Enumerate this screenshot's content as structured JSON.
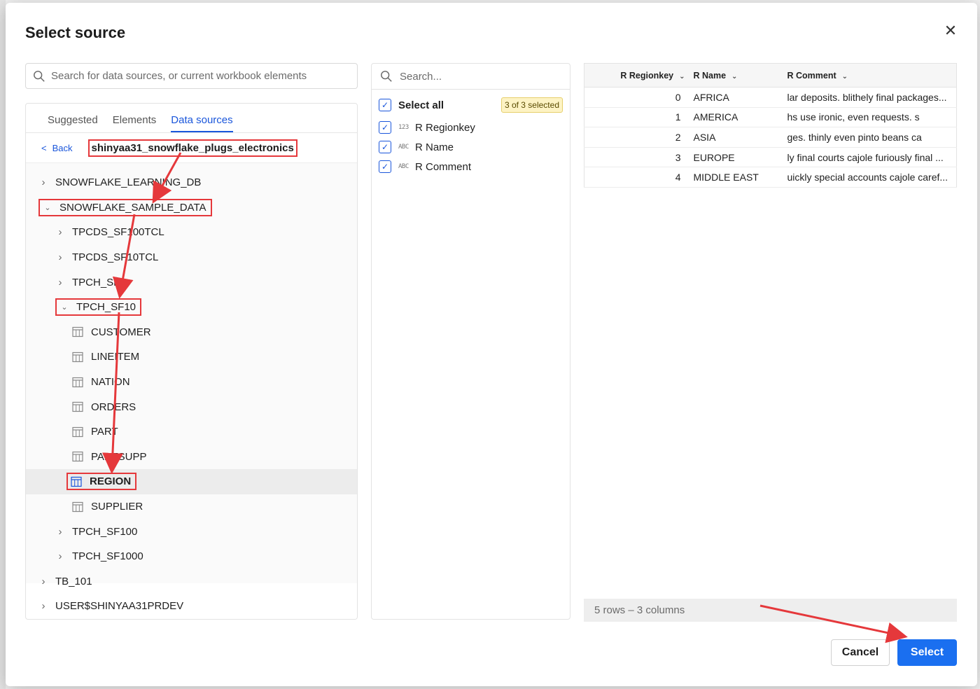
{
  "dialog": {
    "title": "Select source",
    "search_placeholder": "Search for data sources, or current workbook elements"
  },
  "tabs": [
    {
      "label": "Suggested"
    },
    {
      "label": "Elements"
    },
    {
      "label": "Data sources",
      "active": true
    }
  ],
  "breadcrumb": {
    "back_label": "Back",
    "current": "shinyaa31_snowflake_plugs_electronics"
  },
  "tree": [
    {
      "label": "SNOWFLAKE_LEARNING_DB",
      "level": 0,
      "expanded": false
    },
    {
      "label": "SNOWFLAKE_SAMPLE_DATA",
      "level": 0,
      "expanded": true
    },
    {
      "label": "TPCDS_SF100TCL",
      "level": 1,
      "expanded": false
    },
    {
      "label": "TPCDS_SF10TCL",
      "level": 1,
      "expanded": false
    },
    {
      "label": "TPCH_SF1",
      "level": 1,
      "expanded": false
    },
    {
      "label": "TPCH_SF10",
      "level": 1,
      "expanded": true
    },
    {
      "label": "CUSTOMER",
      "level": 2,
      "table": true
    },
    {
      "label": "LINEITEM",
      "level": 2,
      "table": true
    },
    {
      "label": "NATION",
      "level": 2,
      "table": true
    },
    {
      "label": "ORDERS",
      "level": 2,
      "table": true
    },
    {
      "label": "PART",
      "level": 2,
      "table": true
    },
    {
      "label": "PARTSUPP",
      "level": 2,
      "table": true
    },
    {
      "label": "REGION",
      "level": 2,
      "table": true,
      "selected": true
    },
    {
      "label": "SUPPLIER",
      "level": 2,
      "table": true
    },
    {
      "label": "TPCH_SF100",
      "level": 1,
      "expanded": false
    },
    {
      "label": "TPCH_SF1000",
      "level": 1,
      "expanded": false
    },
    {
      "label": "TB_101",
      "level": 0,
      "expanded": false
    },
    {
      "label": "USER$SHINYAA31PRDEV",
      "level": 0,
      "expanded": false
    }
  ],
  "columns_panel": {
    "search_placeholder": "Search...",
    "select_all_label": "Select all",
    "selected_badge": "3 of 3 selected",
    "columns": [
      {
        "type": "123",
        "label": "R Regionkey",
        "checked": true
      },
      {
        "type": "ABC",
        "label": "R Name",
        "checked": true
      },
      {
        "type": "ABC",
        "label": "R Comment",
        "checked": true
      }
    ]
  },
  "preview": {
    "headers": [
      "R Regionkey",
      "R Name",
      "R Comment"
    ],
    "rows": [
      [
        "0",
        "AFRICA",
        "lar deposits. blithely final packages..."
      ],
      [
        "1",
        "AMERICA",
        "hs use ironic, even requests. s"
      ],
      [
        "2",
        "ASIA",
        "ges. thinly even pinto beans ca"
      ],
      [
        "3",
        "EUROPE",
        "ly final courts cajole furiously final ..."
      ],
      [
        "4",
        "MIDDLE EAST",
        "uickly special accounts cajole caref..."
      ]
    ],
    "summary": "5 rows – 3 columns"
  },
  "buttons": {
    "cancel": "Cancel",
    "select": "Select"
  },
  "colors": {
    "accent": "#1a56db",
    "primary_button": "#1a6ff0",
    "annotation": "#e5383b",
    "badge_bg": "#fdf3c4"
  }
}
